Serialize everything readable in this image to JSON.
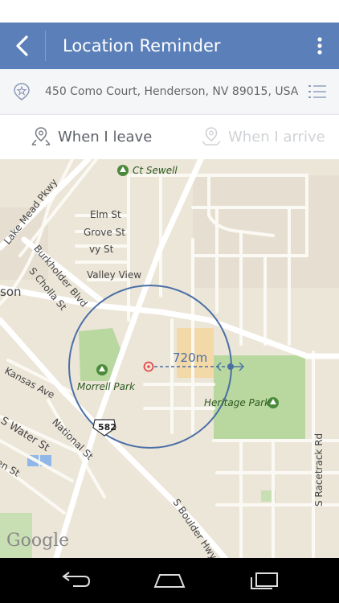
{
  "header": {
    "title": "Location Reminder"
  },
  "address": {
    "text": "450 Como Court, Henderson, NV 89015, USA"
  },
  "modes": {
    "leave": "When I leave",
    "arrive": "When I arrive"
  },
  "map": {
    "radius_label": "720m",
    "labels": {
      "ct_sewell": "Ct Sewell",
      "elm": "Elm St",
      "grove": "Grove St",
      "ivy": "vy St",
      "valley": "Valley View",
      "lake_mead": "Lake Mead Pkwy",
      "burkholder": "Burkholder Blvd",
      "cholla": "S Cholla St",
      "son": "son",
      "kansas": "Kansas Ave",
      "morrell": "Morrell Park",
      "heritage": "Heritage Park",
      "racetrack": "S Racetrack Rd",
      "water": "S Water St",
      "national": "National St",
      "en": "en St",
      "boulder": "S Boulder Hwy",
      "route": "582",
      "google": "Google"
    }
  },
  "colors": {
    "appbar": "#5b7fb8",
    "circle": "#4a6fa5",
    "park": "#b8d8a0",
    "map_bg": "#ece6d9"
  }
}
